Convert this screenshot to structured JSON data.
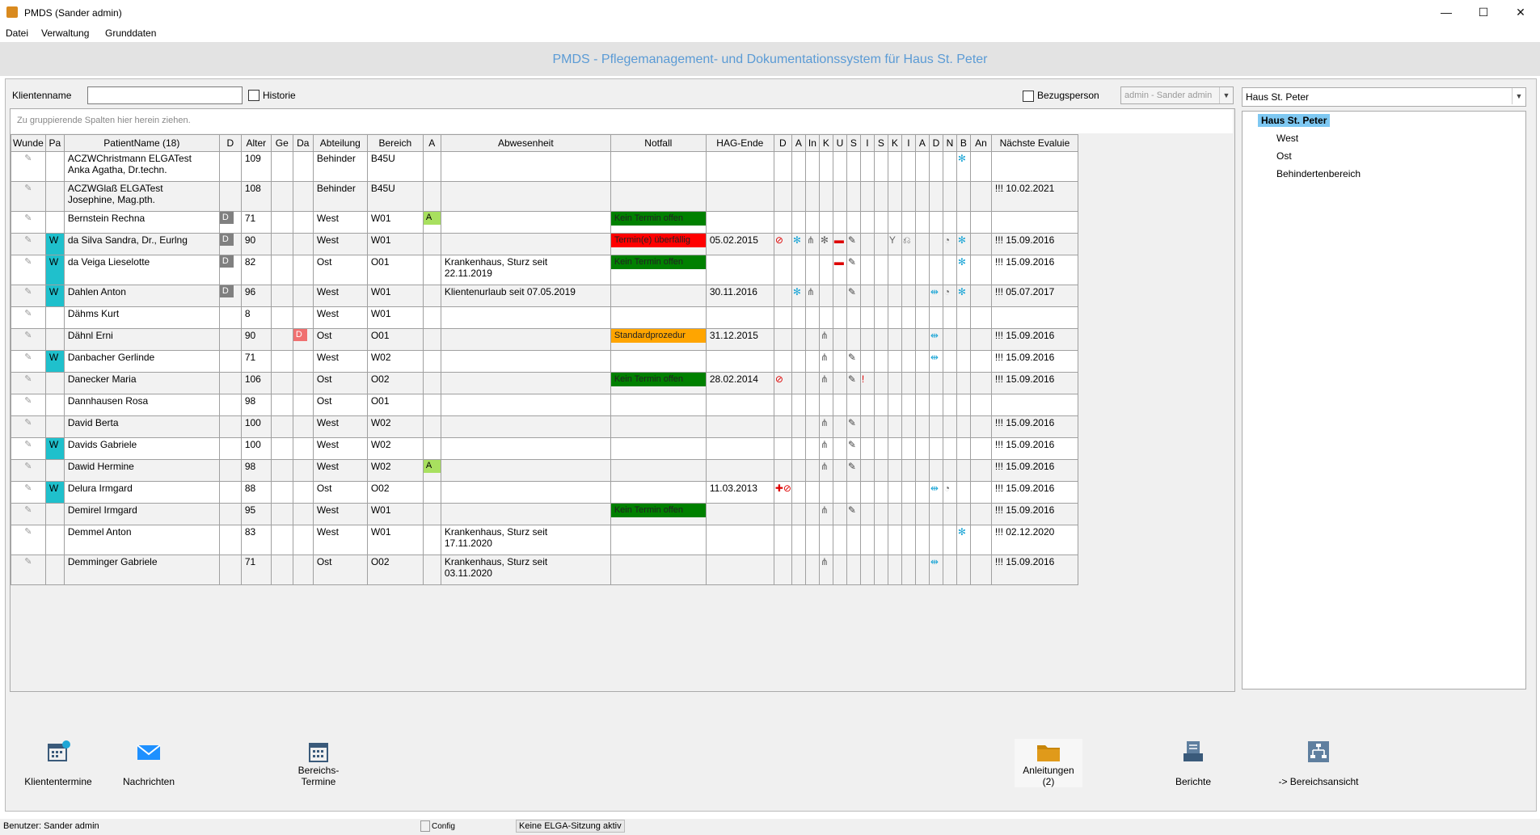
{
  "window": {
    "title": "PMDS (Sander admin)"
  },
  "menu": [
    "Datei",
    "Verwaltung",
    "Grunddaten"
  ],
  "header": {
    "title": "PMDS - Pflegemanagement- und Dokumentationssystem für Haus St. Peter"
  },
  "filter": {
    "klientenname_label": "Klientenname",
    "klientenname_value": "",
    "historie_label": "Historie",
    "bezugsperson_label": "Bezugsperson",
    "bezugsperson_value": "admin - Sander admin"
  },
  "grid": {
    "group_hint": "Zu gruppierende Spalten hier herein ziehen.",
    "columns": [
      "Wunde",
      "Pa",
      "PatientName (18)",
      "D",
      "Alter",
      "Ge",
      "Da",
      "Abteilung",
      "Bereich",
      "A",
      "Abwesenheit",
      "Notfall",
      "HAG-Ende",
      "D",
      "A",
      "In",
      "K",
      "U",
      "S",
      "I",
      "S",
      "K",
      "I",
      "A",
      "D",
      "N",
      "B",
      "An",
      "Nächste Evaluie"
    ],
    "rows": [
      {
        "name1": "ACZWChristmann ELGATest",
        "name2": "Anka Agatha, Dr.techn.",
        "wunde": "",
        "d": "",
        "alter": "109",
        "da": "",
        "abteilung": "Behinder",
        "bereich": "B45U",
        "a": "",
        "abw1": "",
        "abw2": "",
        "notfall": "",
        "nf_color": "",
        "hag": "",
        "icons": {
          "b": "✻"
        },
        "eval": ""
      },
      {
        "name1": "ACZWGlaß ELGATest",
        "name2": "Josephine, Mag.pth.",
        "wunde": "",
        "d": "",
        "alter": "108",
        "da": "",
        "abteilung": "Behinder",
        "bereich": "B45U",
        "a": "",
        "abw1": "",
        "abw2": "",
        "notfall": "",
        "nf_color": "",
        "hag": "",
        "icons": {},
        "eval": "!!! 10.02.2021"
      },
      {
        "name1": "Bernstein Rechna",
        "name2": "",
        "wunde": "",
        "d": "D",
        "alter": "71",
        "da": "",
        "abteilung": "West",
        "bereich": "W01",
        "a": "A",
        "abw1": "",
        "abw2": "",
        "notfall": "Kein Termin offen",
        "nf_color": "g",
        "hag": "",
        "icons": {},
        "eval": ""
      },
      {
        "name1": "da Silva Sandra, Dr., Eurlng",
        "name2": "",
        "wunde": "W",
        "d": "D",
        "alter": "90",
        "da": "",
        "abteilung": "West",
        "bereich": "W01",
        "a": "",
        "abw1": "",
        "abw2": "",
        "notfall": "Termin(e) überfällig",
        "nf_color": "r",
        "hag": "05.02.2015",
        "icons": {
          "d": "⊘",
          "a": "✻",
          "in": "⋔",
          "k": "✻",
          "u": "▬",
          "s": "✎",
          "i2": "⎌",
          "k2": "Y",
          "i3": "♦",
          "n": "◔",
          "b": "✻"
        },
        "eval": "!!! 15.09.2016"
      },
      {
        "name1": "da Veiga Lieselotte",
        "name2": "",
        "wunde": "W",
        "d": "D",
        "alter": "82",
        "da": "",
        "abteilung": "Ost",
        "bereich": "O01",
        "a": "",
        "abw1": "Krankenhaus, Sturz seit",
        "abw2": "22.11.2019",
        "notfall": "Kein Termin offen",
        "nf_color": "g",
        "hag": "",
        "icons": {
          "u": "▬",
          "s": "✎",
          "b": "✻"
        },
        "eval": "!!! 15.09.2016"
      },
      {
        "name1": "Dahlen Anton",
        "name2": "",
        "wunde": "W",
        "d": "D",
        "alter": "96",
        "da": "",
        "abteilung": "West",
        "bereich": "W01",
        "a": "",
        "abw1": "Klientenurlaub seit 07.05.2019",
        "abw2": "",
        "notfall": "",
        "nf_color": "",
        "hag": "30.11.2016",
        "icons": {
          "a": "✻",
          "in": "⋔",
          "s": "✎",
          "d2": "⇹",
          "n": "◔",
          "b": "✻"
        },
        "eval": "!!! 05.07.2017"
      },
      {
        "name1": "Dähms Kurt",
        "name2": "",
        "wunde": "",
        "d": "",
        "alter": "8",
        "da": "",
        "abteilung": "West",
        "bereich": "W01",
        "a": "",
        "abw1": "",
        "abw2": "",
        "notfall": "",
        "nf_color": "",
        "hag": "",
        "icons": {},
        "eval": ""
      },
      {
        "name1": "Dähnl Erni",
        "name2": "",
        "wunde": "",
        "d": "",
        "alter": "90",
        "da": "D",
        "abteilung": "Ost",
        "bereich": "O01",
        "a": "",
        "abw1": "",
        "abw2": "",
        "notfall": "Standardprozedur",
        "nf_color": "o",
        "hag": "31.12.2015",
        "icons": {
          "k": "⋔",
          "d2": "⇹"
        },
        "eval": "!!! 15.09.2016"
      },
      {
        "name1": "Danbacher Gerlinde",
        "name2": "",
        "wunde": "W",
        "d": "",
        "alter": "71",
        "da": "",
        "abteilung": "West",
        "bereich": "W02",
        "a": "",
        "abw1": "",
        "abw2": "",
        "notfall": "",
        "nf_color": "",
        "hag": "",
        "icons": {
          "k": "⋔",
          "s": "✎",
          "d2": "⇹"
        },
        "eval": "!!! 15.09.2016"
      },
      {
        "name1": "Danecker Maria",
        "name2": "",
        "wunde": "",
        "d": "",
        "alter": "106",
        "da": "",
        "abteilung": "Ost",
        "bereich": "O02",
        "a": "",
        "abw1": "",
        "abw2": "",
        "notfall": "Kein Termin offen",
        "nf_color": "g",
        "hag": "28.02.2014",
        "icons": {
          "d": "⊘",
          "k": "⋔",
          "s": "✎",
          "i": "!"
        },
        "eval": "!!! 15.09.2016"
      },
      {
        "name1": "Dannhausen Rosa",
        "name2": "",
        "wunde": "",
        "d": "",
        "alter": "98",
        "da": "",
        "abteilung": "Ost",
        "bereich": "O01",
        "a": "",
        "abw1": "",
        "abw2": "",
        "notfall": "",
        "nf_color": "",
        "hag": "",
        "icons": {},
        "eval": ""
      },
      {
        "name1": "David Berta",
        "name2": "",
        "wunde": "",
        "d": "",
        "alter": "100",
        "da": "",
        "abteilung": "West",
        "bereich": "W02",
        "a": "",
        "abw1": "",
        "abw2": "",
        "notfall": "",
        "nf_color": "",
        "hag": "",
        "icons": {
          "k": "⋔",
          "s": "✎"
        },
        "eval": "!!! 15.09.2016"
      },
      {
        "name1": "Davids Gabriele",
        "name2": "",
        "wunde": "W",
        "d": "",
        "alter": "100",
        "da": "",
        "abteilung": "West",
        "bereich": "W02",
        "a": "",
        "abw1": "",
        "abw2": "",
        "notfall": "",
        "nf_color": "",
        "hag": "",
        "icons": {
          "k": "⋔",
          "s": "✎"
        },
        "eval": "!!! 15.09.2016"
      },
      {
        "name1": "Dawid Hermine",
        "name2": "",
        "wunde": "",
        "d": "",
        "alter": "98",
        "da": "",
        "abteilung": "West",
        "bereich": "W02",
        "a": "A",
        "abw1": "",
        "abw2": "",
        "notfall": "",
        "nf_color": "",
        "hag": "",
        "icons": {
          "k": "⋔",
          "s": "✎"
        },
        "eval": "!!! 15.09.2016"
      },
      {
        "name1": "Delura Irmgard",
        "name2": "",
        "wunde": "W",
        "d": "",
        "alter": "88",
        "da": "",
        "abteilung": "Ost",
        "bereich": "O02",
        "a": "",
        "abw1": "",
        "abw2": "",
        "notfall": "",
        "nf_color": "",
        "hag": "11.03.2013",
        "icons": {
          "d": "✚⊘",
          "d2": "⇹",
          "n": "◔"
        },
        "eval": "!!! 15.09.2016"
      },
      {
        "name1": "Demirel Irmgard",
        "name2": "",
        "wunde": "",
        "d": "",
        "alter": "95",
        "da": "",
        "abteilung": "West",
        "bereich": "W01",
        "a": "",
        "abw1": "",
        "abw2": "",
        "notfall": "Kein Termin offen",
        "nf_color": "g",
        "hag": "",
        "icons": {
          "k": "⋔",
          "s": "✎"
        },
        "eval": "!!! 15.09.2016"
      },
      {
        "name1": "Demmel Anton",
        "name2": "",
        "wunde": "",
        "d": "",
        "alter": "83",
        "da": "",
        "abteilung": "West",
        "bereich": "W01",
        "a": "",
        "abw1": "Krankenhaus, Sturz seit",
        "abw2": "17.11.2020",
        "notfall": "",
        "nf_color": "",
        "hag": "",
        "icons": {
          "b": "✻"
        },
        "eval": "!!! 02.12.2020"
      },
      {
        "name1": "Demminger Gabriele",
        "name2": "",
        "wunde": "",
        "d": "",
        "alter": "71",
        "da": "",
        "abteilung": "Ost",
        "bereich": "O02",
        "a": "",
        "abw1": "Krankenhaus, Sturz seit",
        "abw2": "03.11.2020",
        "notfall": "",
        "nf_color": "",
        "hag": "",
        "icons": {
          "k": "⋔",
          "d2": "⇹"
        },
        "eval": "!!! 15.09.2016"
      }
    ]
  },
  "tree": {
    "combo_value": "Haus St. Peter",
    "root": "Haus St. Peter",
    "children": [
      "West",
      "Ost",
      "Behindertenbereich"
    ]
  },
  "bottom": {
    "klienten": "Kliententermine",
    "nachrichten": "Nachrichten",
    "bereichs1": "Bereichs-",
    "bereichs2": "Termine",
    "anleitungen1": "Anleitungen",
    "anleitungen2": "(2)",
    "berichte": "Berichte",
    "bereichsansicht": "-> Bereichsansicht"
  },
  "status": {
    "user": "Benutzer: Sander admin",
    "config": "Config",
    "elga": "Keine ELGA-Sitzung aktiv"
  },
  "colors": {
    "accent": "#5b9bd5",
    "wunde": "#1fc0cc",
    "notfall_green": "#008000",
    "notfall_red": "#ff0000",
    "notfall_orange": "#ffa500",
    "tree_selected": "#7ec8f2"
  }
}
